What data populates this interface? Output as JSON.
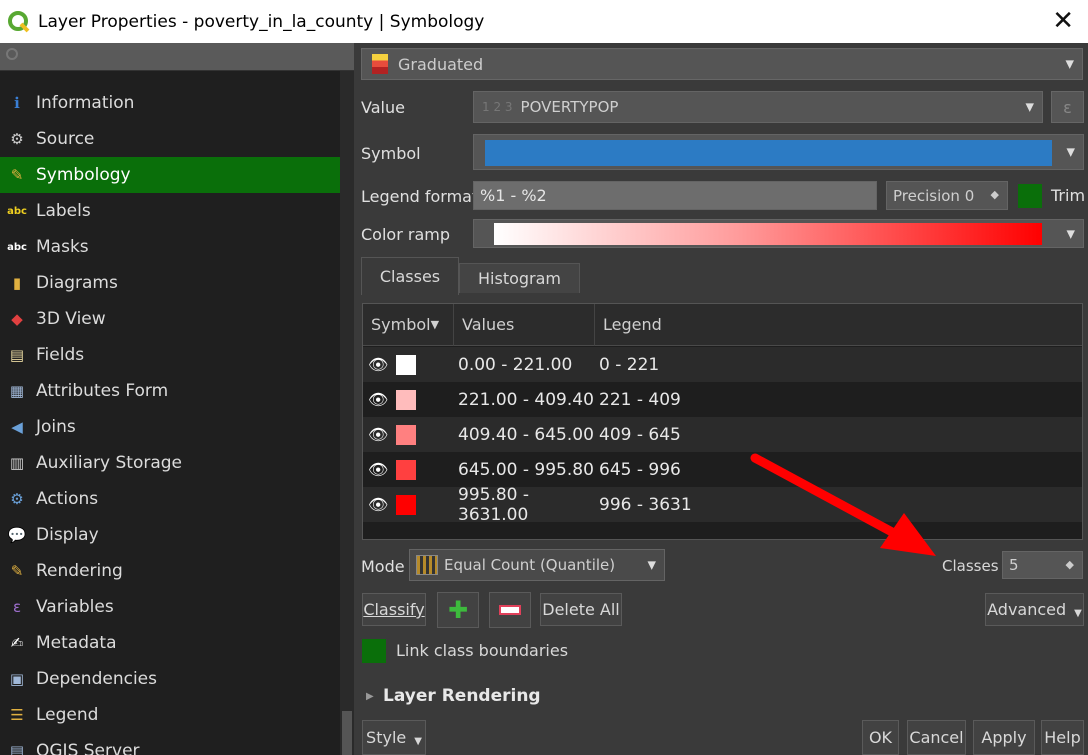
{
  "window": {
    "title": "Layer Properties - poverty_in_la_county | Symbology",
    "close_glyph": "✕"
  },
  "sidebar": {
    "items": [
      {
        "label": "Information",
        "icon": "info-icon",
        "glyph": "ℹ",
        "color": "#3a7fd5"
      },
      {
        "label": "Source",
        "icon": "source-gear-icon",
        "glyph": "⚙",
        "color": "#cccccc"
      },
      {
        "label": "Symbology",
        "icon": "brush-icon",
        "glyph": "✎",
        "color": "#e0b040"
      },
      {
        "label": "Labels",
        "icon": "abc-label-icon",
        "glyph": "abc",
        "color": "#f0d020"
      },
      {
        "label": "Masks",
        "icon": "abc-mask-icon",
        "glyph": "abc",
        "color": "#ffffff"
      },
      {
        "label": "Diagrams",
        "icon": "diagram-icon",
        "glyph": "▮",
        "color": "#e0b040"
      },
      {
        "label": "3D View",
        "icon": "cube-icon",
        "glyph": "◆",
        "color": "#e04040"
      },
      {
        "label": "Fields",
        "icon": "fields-icon",
        "glyph": "▤",
        "color": "#e8d8a0"
      },
      {
        "label": "Attributes Form",
        "icon": "form-icon",
        "glyph": "▦",
        "color": "#a0b8d8"
      },
      {
        "label": "Joins",
        "icon": "joins-icon",
        "glyph": "◀",
        "color": "#6aa0d8"
      },
      {
        "label": "Auxiliary Storage",
        "icon": "database-icon",
        "glyph": "▥",
        "color": "#cccccc"
      },
      {
        "label": "Actions",
        "icon": "actions-gear-icon",
        "glyph": "⚙",
        "color": "#6aa0d8"
      },
      {
        "label": "Display",
        "icon": "speech-bubble-icon",
        "glyph": "💬",
        "color": "#e8d070"
      },
      {
        "label": "Rendering",
        "icon": "paintbrush-icon",
        "glyph": "✎",
        "color": "#e0b040"
      },
      {
        "label": "Variables",
        "icon": "epsilon-icon",
        "glyph": "ε",
        "color": "#a070d0"
      },
      {
        "label": "Metadata",
        "icon": "metadata-icon",
        "glyph": "✍",
        "color": "#ffffff"
      },
      {
        "label": "Dependencies",
        "icon": "dependencies-icon",
        "glyph": "▣",
        "color": "#a0b8d8"
      },
      {
        "label": "Legend",
        "icon": "legend-icon",
        "glyph": "☰",
        "color": "#e0b040"
      },
      {
        "label": "QGIS Server",
        "icon": "server-icon",
        "glyph": "▤",
        "color": "#a0b8d8"
      }
    ],
    "active_index": 2
  },
  "renderer": {
    "label": "Graduated"
  },
  "value": {
    "label": "Value",
    "type_hint": "1 2 3",
    "field": "POVERTYPOP"
  },
  "symbol": {
    "label": "Symbol",
    "color": "#2c7bc4"
  },
  "legend_format": {
    "label": "Legend format",
    "value": "%1 - %2",
    "precision": "Precision 0",
    "trim": "Trim"
  },
  "color_ramp": {
    "label": "Color ramp",
    "start": "#ffffff",
    "end": "#ff0000"
  },
  "tabs": {
    "classes": "Classes",
    "histogram": "Histogram"
  },
  "table": {
    "headers": [
      "Symbol",
      "Values",
      "Legend"
    ],
    "rows": [
      {
        "color": "#ffffff",
        "values": "0.00 - 221.00",
        "legend": "0 - 221"
      },
      {
        "color": "#ffbcbc",
        "values": "221.00 - 409.40",
        "legend": "221 - 409"
      },
      {
        "color": "#ff8080",
        "values": "409.40 - 645.00",
        "legend": "409 - 645"
      },
      {
        "color": "#ff4040",
        "values": "645.00 - 995.80",
        "legend": "645 - 996"
      },
      {
        "color": "#ff0000",
        "values": "995.80 - 3631.00",
        "legend": "996 - 3631"
      }
    ]
  },
  "mode": {
    "label": "Mode",
    "value": "Equal Count (Quantile)"
  },
  "classes": {
    "label": "Classes",
    "value": "5"
  },
  "buttons": {
    "classify": "Classify",
    "plus": "✚",
    "delete_all": "Delete All",
    "advanced": "Advanced",
    "style": "Style",
    "ok": "OK",
    "cancel": "Cancel",
    "apply": "Apply",
    "help": "Help"
  },
  "link_class_boundaries": "Link class boundaries",
  "layer_rendering": "Layer Rendering",
  "annotation": {
    "color": "#ff0000"
  }
}
